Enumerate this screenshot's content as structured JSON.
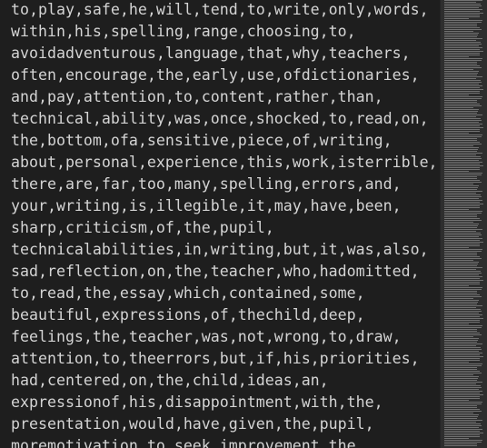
{
  "editor": {
    "lines": [
      "to,play,safe,he,will,tend,to,write,only,words,",
      "within,his,spelling,range,choosing,to,",
      "avoidadventurous,language,that,why,teachers,",
      "often,encourage,the,early,use,ofdictionaries,",
      "and,pay,attention,to,content,rather,than,",
      "technical,ability,was,once,shocked,to,read,on,",
      "the,bottom,ofa,sensitive,piece,of,writing,",
      "about,personal,experience,this,work,isterrible,",
      "there,are,far,too,many,spelling,errors,and,",
      "your,writing,is,illegible,it,may,have,been,",
      "sharp,criticism,of,the,pupil,",
      "technicalabilities,in,writing,but,it,was,also,",
      "sad,reflection,on,the,teacher,who,hadomitted,",
      "to,read,the,essay,which,contained,some,",
      "beautiful,expressions,of,thechild,deep,",
      "feelings,the,teacher,was,not,wrong,to,draw,",
      "attention,to,theerrors,but,if,his,priorities,",
      "had,centered,on,the,child,ideas,an,",
      "expressionof,his,disappointment,with,the,",
      "presentation,would,have,given,the,pupil,",
      "moremotivation,to,seek,improvement,the,"
    ]
  }
}
